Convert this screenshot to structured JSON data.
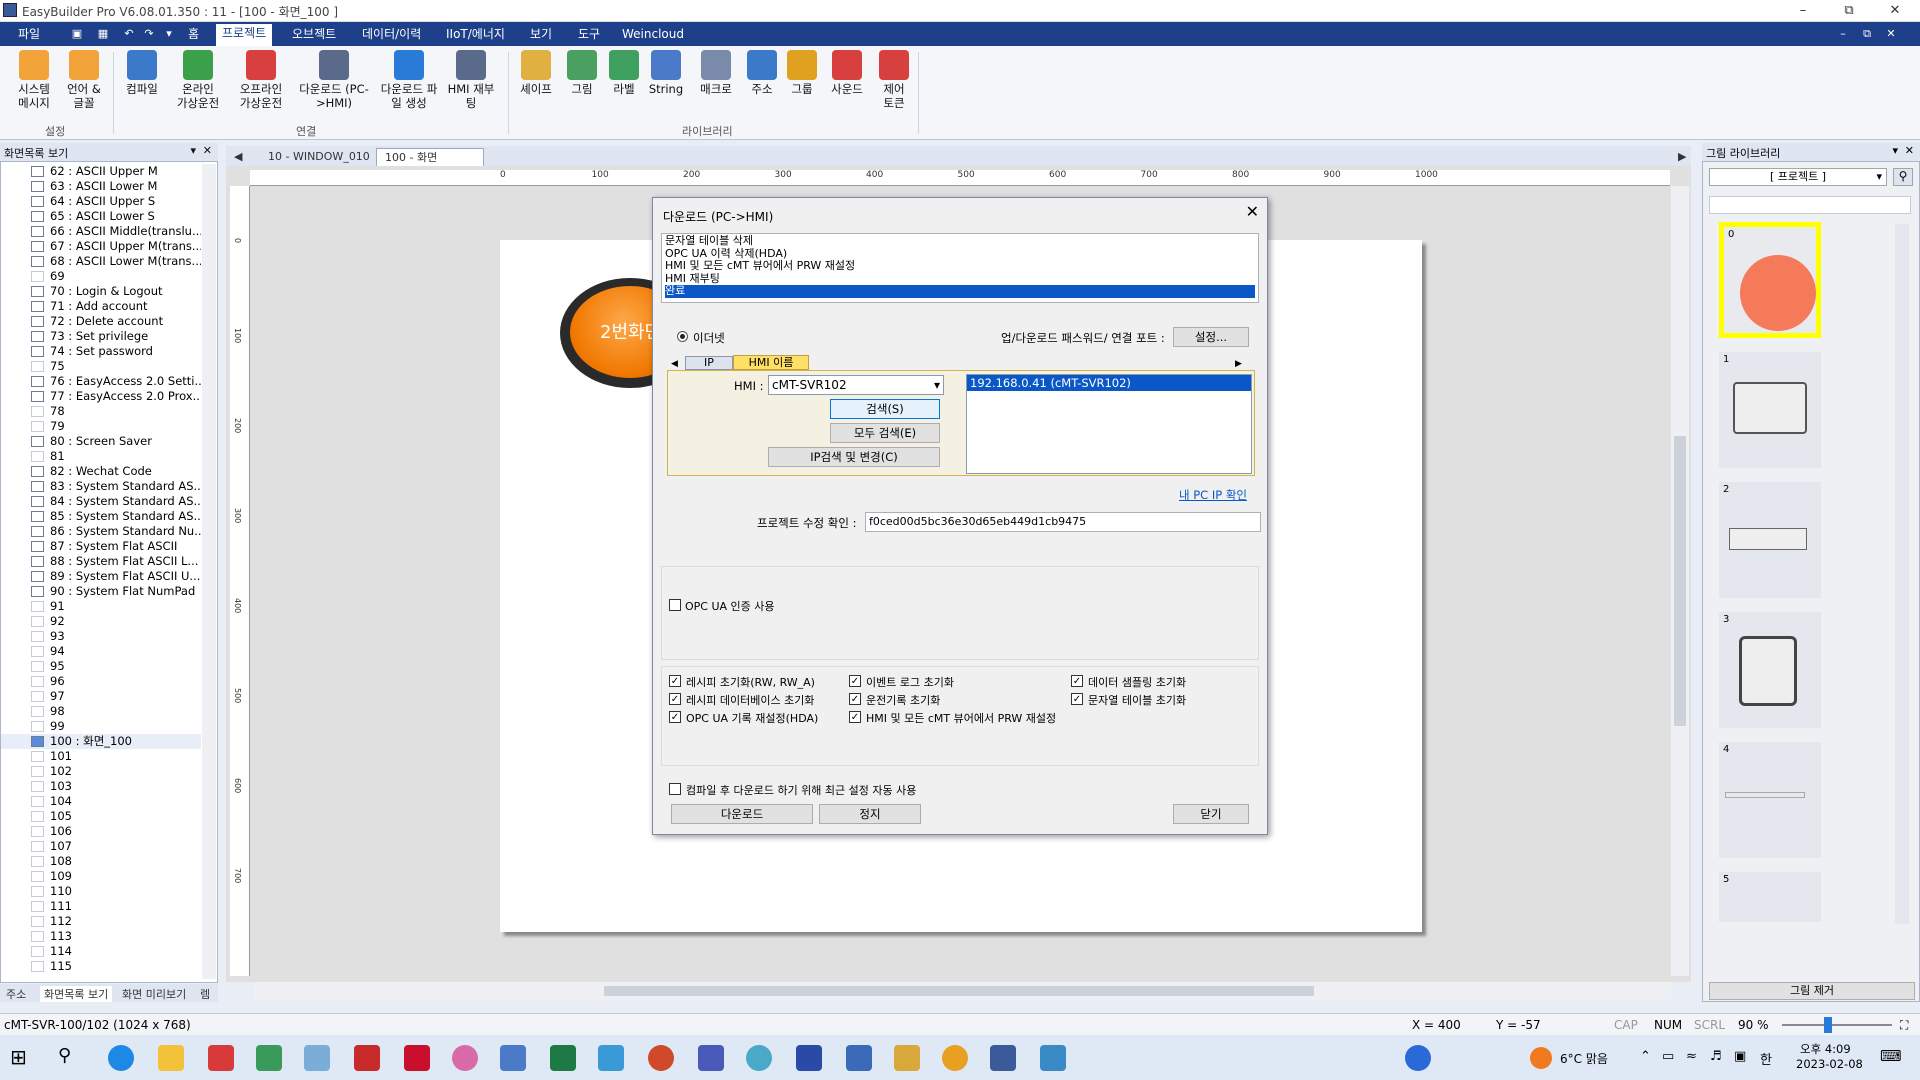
{
  "window": {
    "title": "EasyBuilder Pro V6.08.01.350 : 11 - [100 - 화면_100 ]"
  },
  "menu": {
    "items": [
      "파일",
      "홈",
      "프로젝트",
      "오브젝트",
      "데이터/이력",
      "IIoT/에너지",
      "보기",
      "도구",
      "Weincloud"
    ],
    "active": "프로젝트"
  },
  "ribbon": {
    "buttons": [
      {
        "label": "시스템\n메시지",
        "color": "#f2a33a"
      },
      {
        "label": "언어 &\n글꼴",
        "color": "#f2a33a"
      },
      {
        "label": "컴파일",
        "color": "#3a7ac8"
      },
      {
        "label": "온라인\n가상운전",
        "color": "#3aa04a"
      },
      {
        "label": "오프라인\n가상운전",
        "color": "#d84040"
      },
      {
        "label": "다운로드 (PC-\n>HMI)",
        "color": "#5a6a8a"
      },
      {
        "label": "다운로드 파\n일 생성",
        "color": "#2a7ad8"
      },
      {
        "label": "HMI 재부\n팅",
        "color": "#5a6a8a"
      },
      {
        "label": "셰이프",
        "color": "#e0b040"
      },
      {
        "label": "그림",
        "color": "#4aa060"
      },
      {
        "label": "라벨",
        "color": "#40a060"
      },
      {
        "label": "String",
        "color": "#4a7ac8"
      },
      {
        "label": "매크로",
        "color": "#7a8aaa"
      },
      {
        "label": "주소",
        "color": "#3a7ac8"
      },
      {
        "label": "그룹",
        "color": "#e0a020"
      },
      {
        "label": "사운드",
        "color": "#d84040"
      },
      {
        "label": "제어\n토큰",
        "color": "#d84040"
      }
    ],
    "groups": [
      "설정",
      "연결",
      "라이브러리"
    ]
  },
  "left_panel": {
    "title": "화면목록 보기",
    "items": [
      "62 : ASCII Upper M",
      "63 : ASCII Lower M",
      "64 : ASCII Upper S",
      "65 : ASCII Lower S",
      "66 : ASCII Middle(translu...",
      "67 : ASCII Upper M(trans...",
      "68 : ASCII Lower M(trans...",
      "69",
      "70 : Login & Logout",
      "71 : Add account",
      "72 : Delete account",
      "73 : Set privilege",
      "74 : Set password",
      "75",
      "76 : EasyAccess 2.0 Setti...",
      "77 : EasyAccess 2.0 Prox...",
      "78",
      "79",
      "80 : Screen Saver",
      "81",
      "82 : Wechat Code",
      "83 : System Standard AS...",
      "84 : System Standard AS...",
      "85 : System Standard AS...",
      "86 : System Standard Nu...",
      "87 : System Flat ASCII",
      "88 : System Flat ASCII L...",
      "89 : System Flat ASCII U...",
      "90 : System Flat NumPad",
      "91",
      "92",
      "93",
      "94",
      "95",
      "96",
      "97",
      "98",
      "99",
      "100 : 화면_100",
      "101",
      "102",
      "103",
      "104",
      "105",
      "106",
      "107",
      "108",
      "109",
      "110",
      "111",
      "112",
      "113",
      "114",
      "115"
    ],
    "tabs": [
      "주소",
      "화면목록 보기",
      "화면 미리보기",
      "렘"
    ]
  },
  "doc_tabs": [
    "10 - WINDOW_010",
    "100 - 화면_100"
  ],
  "canvas": {
    "button_text": "2번화면",
    "ruler_labels": [
      "0",
      "100",
      "200",
      "300",
      "400",
      "500",
      "600",
      "700",
      "800",
      "900",
      "1000"
    ]
  },
  "right_panel": {
    "title": "그림 라이브러리",
    "dropdown": "[ 프로젝트 ]",
    "thumb_numbers": [
      "0",
      "1",
      "2",
      "3",
      "4",
      "5"
    ],
    "remove_button": "그림 제거"
  },
  "dialog": {
    "title": "다운로드 (PC->HMI)",
    "log": [
      "문자열 테이블 삭제",
      "OPC UA 이력 삭제(HDA)",
      "HMI 및 모든 cMT 뷰어에서 PRW 재설정",
      "HMI 재부팅",
      "완료"
    ],
    "ethernet": "이더넷",
    "pw_label": "업/다운로드 패스워드/ 연결 포트 :",
    "settings_btn": "설정...",
    "tab_ip": "IP",
    "tab_hmi": "HMI 이름",
    "hmi_label": "HMI :",
    "hmi_value": "cMT-SVR102",
    "search_btn": "검색(S)",
    "search_all_btn": "모두 검색(E)",
    "ip_btn": "IP검색 및 변경(C)",
    "found": "192.168.0.41 (cMT-SVR102)",
    "my_ip": "내 PC IP 확인",
    "rev_label": "프로젝트 수정 확인 :",
    "rev_value": "f0ced00d5bc36e30d65eb449d1cb9475",
    "opc_auth": "OPC UA 인증 사용",
    "checks": [
      "레시피 초기화(RW, RW_A)",
      "이벤트 로그 초기화",
      "데이터 샘플링 초기화",
      "레시피 데이터베이스 초기화",
      "운전기록 초기화",
      "문자열 테이블 초기화",
      "OPC UA 기록 재설정(HDA)",
      "HMI 및 모든 cMT 뷰어에서 PRW 재설정"
    ],
    "compile_chk": "컴파일 후 다운로드 하기 위해 최근 설정 자동 사용",
    "download_btn": "다운로드",
    "stop_btn": "정지",
    "close_btn": "닫기"
  },
  "status": {
    "model": "cMT-SVR-100/102 (1024 x 768)",
    "x": "X = 400",
    "y": "Y = -57",
    "cap": "CAP",
    "num": "NUM",
    "scrl": "SCRL",
    "zoom": "90 %"
  },
  "taskbar": {
    "weather": "6°C 맑음",
    "time": "오후 4:09",
    "date": "2023-02-08",
    "lang": "한"
  }
}
